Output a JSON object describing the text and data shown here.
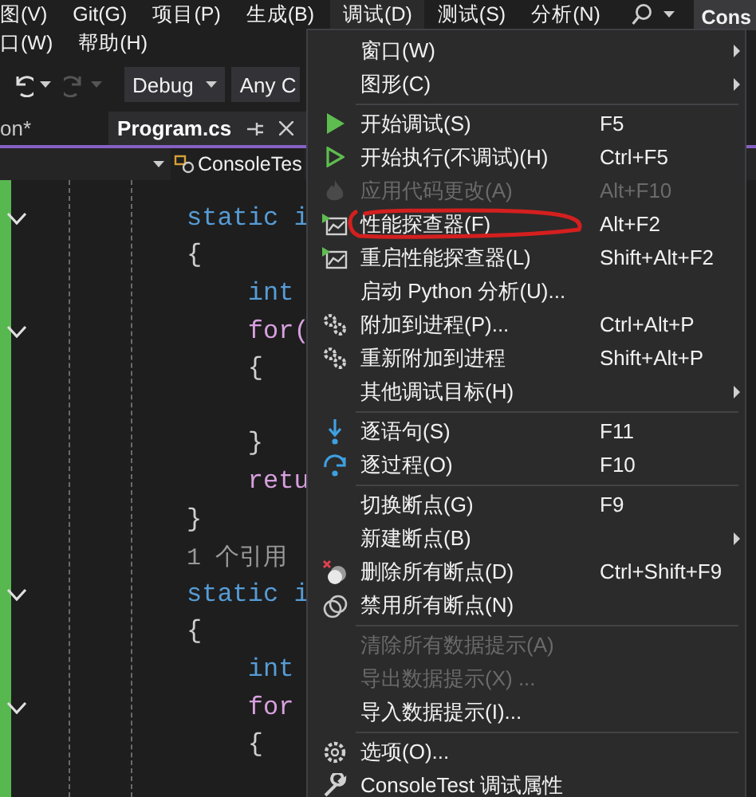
{
  "menubar": {
    "rows": [
      [
        {
          "label": "图(V)",
          "selected": false
        },
        {
          "label": "Git(G)",
          "selected": false
        },
        {
          "label": "项目(P)",
          "selected": false
        },
        {
          "label": "生成(B)",
          "selected": false
        },
        {
          "label": "调试(D)",
          "selected": true
        },
        {
          "label": "测试(S)",
          "selected": false
        },
        {
          "label": "分析(N)",
          "selected": false
        }
      ],
      [
        {
          "label": "口(W)",
          "selected": false
        },
        {
          "label": "帮助(H)",
          "selected": false
        }
      ]
    ],
    "title": "Cons"
  },
  "toolbar": {
    "configuration": "Debug",
    "platform": "Any C"
  },
  "tabs": [
    {
      "label": "on*",
      "selected": false
    },
    {
      "label": "Program.cs",
      "selected": true
    }
  ],
  "navbar": {
    "type": "ConsoleTes"
  },
  "code": [
    {
      "text": "static i",
      "kind": "keyword",
      "fold": true
    },
    {
      "text": "{",
      "kind": "punct",
      "fold": false
    },
    {
      "text": "    int",
      "kind": "keyword",
      "fold": false
    },
    {
      "text": "    for(",
      "kind": "control",
      "fold": true
    },
    {
      "text": "    {",
      "kind": "punct",
      "fold": false
    },
    {
      "kind": "blank",
      "fold": false
    },
    {
      "text": "    }",
      "kind": "punct",
      "fold": false
    },
    {
      "text": "    retu",
      "kind": "control",
      "fold": false
    },
    {
      "text": "}",
      "kind": "punct",
      "fold": false
    },
    {
      "text": "1 个引用",
      "kind": "codelens",
      "fold": false
    },
    {
      "text": "static i",
      "kind": "keyword",
      "fold": true
    },
    {
      "text": "{",
      "kind": "punct",
      "fold": false
    },
    {
      "text": "    int",
      "kind": "keyword",
      "fold": false
    },
    {
      "text": "    for",
      "kind": "control",
      "fold": true
    },
    {
      "text": "    {",
      "kind": "punct",
      "fold": false
    }
  ],
  "menu": [
    {
      "kind": "plain",
      "label": "窗口(W)",
      "submenu": true,
      "disabled": false
    },
    {
      "kind": "plain",
      "label": "图形(C)",
      "submenu": true,
      "disabled": false
    },
    {
      "kind": "separator"
    },
    {
      "kind": "start",
      "label": "开始调试(S)",
      "shortcut": "F5",
      "submenu": false,
      "disabled": false
    },
    {
      "kind": "run",
      "label": "开始执行(不调试)(H)",
      "shortcut": "Ctrl+F5",
      "submenu": false,
      "disabled": false
    },
    {
      "kind": "hotreload",
      "label": "应用代码更改(A)",
      "shortcut": "Alt+F10",
      "submenu": false,
      "disabled": true
    },
    {
      "kind": "profiler",
      "label": "性能探查器(F)",
      "shortcut": "Alt+F2",
      "submenu": false,
      "disabled": false
    },
    {
      "kind": "profiler",
      "label": "重启性能探查器(L)",
      "shortcut": "Shift+Alt+F2",
      "submenu": false,
      "disabled": false
    },
    {
      "kind": "plain",
      "label": "启动 Python 分析(U)...",
      "submenu": false,
      "disabled": false
    },
    {
      "kind": "attach",
      "label": "附加到进程(P)...",
      "shortcut": "Ctrl+Alt+P",
      "submenu": false,
      "disabled": false
    },
    {
      "kind": "attach",
      "label": "重新附加到进程",
      "shortcut": "Shift+Alt+P",
      "submenu": false,
      "disabled": false
    },
    {
      "kind": "plain",
      "label": "其他调试目标(H)",
      "submenu": true,
      "disabled": false
    },
    {
      "kind": "separator"
    },
    {
      "kind": "stepinto",
      "label": "逐语句(S)",
      "shortcut": "F11",
      "submenu": false,
      "disabled": false
    },
    {
      "kind": "stepover",
      "label": "逐过程(O)",
      "shortcut": "F10",
      "submenu": false,
      "disabled": false
    },
    {
      "kind": "separator"
    },
    {
      "kind": "plain",
      "label": "切换断点(G)",
      "shortcut": "F9",
      "submenu": false,
      "disabled": false
    },
    {
      "kind": "plain",
      "label": "新建断点(B)",
      "submenu": true,
      "disabled": false
    },
    {
      "kind": "deletebreakpoints",
      "label": "删除所有断点(D)",
      "shortcut": "Ctrl+Shift+F9",
      "submenu": false,
      "disabled": false
    },
    {
      "kind": "disablebreakpoints",
      "label": "禁用所有断点(N)",
      "submenu": false,
      "disabled": false
    },
    {
      "kind": "separator"
    },
    {
      "kind": "plain",
      "label": "清除所有数据提示(A)",
      "submenu": false,
      "disabled": true
    },
    {
      "kind": "plain",
      "label": "导出数据提示(X) ...",
      "submenu": false,
      "disabled": true
    },
    {
      "kind": "plain",
      "label": "导入数据提示(I)...",
      "submenu": false,
      "disabled": false
    },
    {
      "kind": "separator"
    },
    {
      "kind": "options",
      "label": "选项(O)...",
      "submenu": false,
      "disabled": false
    },
    {
      "kind": "properties",
      "label": "ConsoleTest 调试属性",
      "submenu": false,
      "disabled": false
    }
  ]
}
